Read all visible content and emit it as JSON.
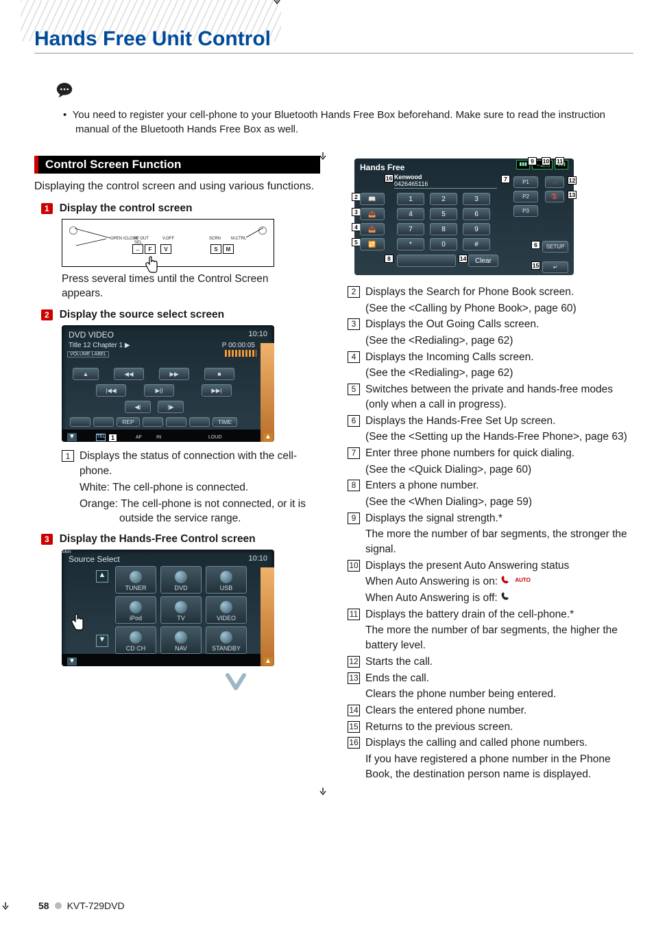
{
  "page": {
    "title": "Hands Free Unit Control",
    "note": "You need to register your cell-phone to your Bluetooth Hands Free Box beforehand. Make sure to read the instruction manual of the Bluetooth Hands Free Box as well.",
    "footer_model": "KVT-729DVD",
    "footer_page": "58"
  },
  "left": {
    "section_title": "Control Screen Function",
    "section_desc": "Displaying the control screen and using various functions.",
    "steps": {
      "s1": {
        "num": "1",
        "title": "Display the control screen"
      },
      "s2": {
        "num": "2",
        "title": "Display the source select screen"
      },
      "s3": {
        "num": "3",
        "title": "Display the Hands-Free Control screen"
      }
    },
    "caption1": "Press several times until the Control Screen appears.",
    "fig1": {
      "labels": [
        "OPEN /CLOSE",
        "AV OUT",
        "SEL",
        "V.OFF",
        "SCRN",
        "M.CTRL"
      ],
      "keys": [
        "F",
        "V",
        "S",
        "M"
      ]
    },
    "fig2": {
      "title": "DVD VIDEO",
      "clock": "10:10",
      "line2_left": "Title 12    Chapter   1   ▶",
      "line2_right": "P    00:00:05",
      "volume_label": "VOLUME LABEL",
      "bottom_labels": [
        "REP",
        "TIME"
      ],
      "foot": [
        "AF",
        "IN",
        "LOUD"
      ],
      "callout": "1"
    },
    "list1": {
      "num": "1",
      "text": "Displays the status of connection with the cell-phone.",
      "sub1": "White: The cell-phone is connected.",
      "sub2": "Orange: The cell-phone is not connected, or it is outside the service range."
    },
    "fig3": {
      "title": "Source Select",
      "clock": "10:10",
      "cells": [
        "TUNER",
        "DVD",
        "USB",
        "iPod",
        "TV",
        "VIDEO",
        "CD CH",
        "NAV",
        "STANDBY"
      ],
      "skin": "Skin"
    }
  },
  "right": {
    "hf": {
      "title": "Hands Free",
      "name": "Kenwood",
      "number": "0426465116",
      "keys": [
        "1",
        "2",
        "3",
        "4",
        "5",
        "6",
        "7",
        "8",
        "9",
        "*",
        "0",
        "#"
      ],
      "preset": [
        "P1",
        "P2",
        "P3"
      ],
      "clear": "Clear",
      "setup": "SETUP",
      "status_auto": "AUTO",
      "callouts": [
        "2",
        "3",
        "4",
        "5",
        "6",
        "7",
        "8",
        "9",
        "10",
        "11",
        "12",
        "13",
        "14",
        "15",
        "16"
      ]
    },
    "items": {
      "i2": {
        "t": "Displays the Search for Phone Book screen.",
        "s": "(See the <Calling by Phone Book>, page 60)"
      },
      "i3": {
        "t": "Displays the Out Going Calls screen.",
        "s": "(See the <Redialing>, page 62)"
      },
      "i4": {
        "t": "Displays the Incoming Calls screen.",
        "s": "(See the <Redialing>, page 62)"
      },
      "i5": {
        "t": "Switches between the private and hands-free modes (only when a call in progress)."
      },
      "i6": {
        "t": "Displays the Hands-Free Set Up screen.",
        "s": "(See the <Setting up the Hands-Free Phone>, page 63)"
      },
      "i7": {
        "t": "Enter three phone numbers for quick dialing.",
        "s": "(See the <Quick Dialing>, page 60)"
      },
      "i8": {
        "t": "Enters a phone number.",
        "s": "(See the <When Dialing>, page 59)"
      },
      "i9": {
        "t": "Displays the signal strength.*",
        "s": "The more the number of bar segments, the stronger the signal."
      },
      "i10": {
        "t": "Displays the present Auto Answering status",
        "s1": "When Auto Answering is on:",
        "s2": "When Auto Answering is off:"
      },
      "i11": {
        "t": "Displays the battery drain of the cell-phone.*",
        "s": "The more the number of bar segments, the higher the battery level."
      },
      "i12": {
        "t": "Starts the call."
      },
      "i13": {
        "t": "Ends the call.",
        "s": "Clears the phone number being entered."
      },
      "i14": {
        "t": "Clears the entered phone number."
      },
      "i15": {
        "t": "Returns to the previous screen."
      },
      "i16": {
        "t": "Displays the calling and called phone numbers.",
        "s": "If you have registered a phone number in the Phone Book, the destination person name is displayed."
      }
    },
    "auto_label": "AUTO"
  }
}
